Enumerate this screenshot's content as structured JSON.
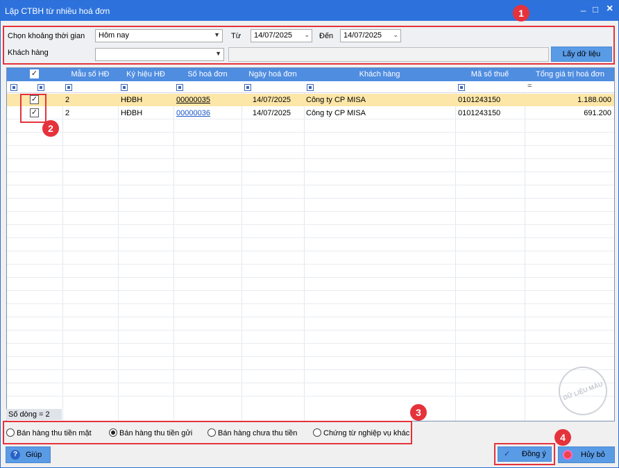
{
  "window": {
    "title": "Lập CTBH từ nhiều hoá đơn"
  },
  "filter": {
    "period_label": "Chọn khoảng thời gian",
    "period_value": "Hôm nay",
    "from_label": "Từ",
    "from_value": "14/07/2025",
    "to_label": "Đến",
    "to_value": "14/07/2025",
    "customer_label": "Khách hàng",
    "customer_value": "",
    "fetch_button": "Lấy dữ liệu"
  },
  "table": {
    "columns": [
      "Mẫu số HĐ",
      "Ký hiệu HĐ",
      "Số hoá đơn",
      "Ngày hoá đơn",
      "Khách hàng",
      "Mã số thuế",
      "Tổng giá trị hoá đơn"
    ],
    "rows": [
      {
        "checked": true,
        "form": "2",
        "symbol": "HĐBH",
        "number": "00000035",
        "date": "14/07/2025",
        "customer": "Công ty CP MISA",
        "tax_code": "0101243150",
        "total": "1.188.000"
      },
      {
        "checked": true,
        "form": "2",
        "symbol": "HĐBH",
        "number": "00000036",
        "date": "14/07/2025",
        "customer": "Công ty CP MISA",
        "tax_code": "0101243150",
        "total": "691.200"
      }
    ],
    "row_count": "Số dòng = 2"
  },
  "sale_types": [
    {
      "label": "Bán hàng thu tiền mặt",
      "selected": false
    },
    {
      "label": "Bán hàng thu tiền gửi",
      "selected": true
    },
    {
      "label": "Bán hàng chưa thu tiền",
      "selected": false
    },
    {
      "label": "Chứng từ nghiệp vụ khác",
      "selected": false
    }
  ],
  "buttons": {
    "help": "Giúp",
    "ok": "Đồng ý",
    "cancel": "Hủy bỏ"
  },
  "callouts": [
    "1",
    "2",
    "3",
    "4"
  ],
  "colors": {
    "accent": "#2d72dc",
    "header": "#4f8de0",
    "selected_row": "#fde7a8",
    "callout": "#e5323b"
  }
}
